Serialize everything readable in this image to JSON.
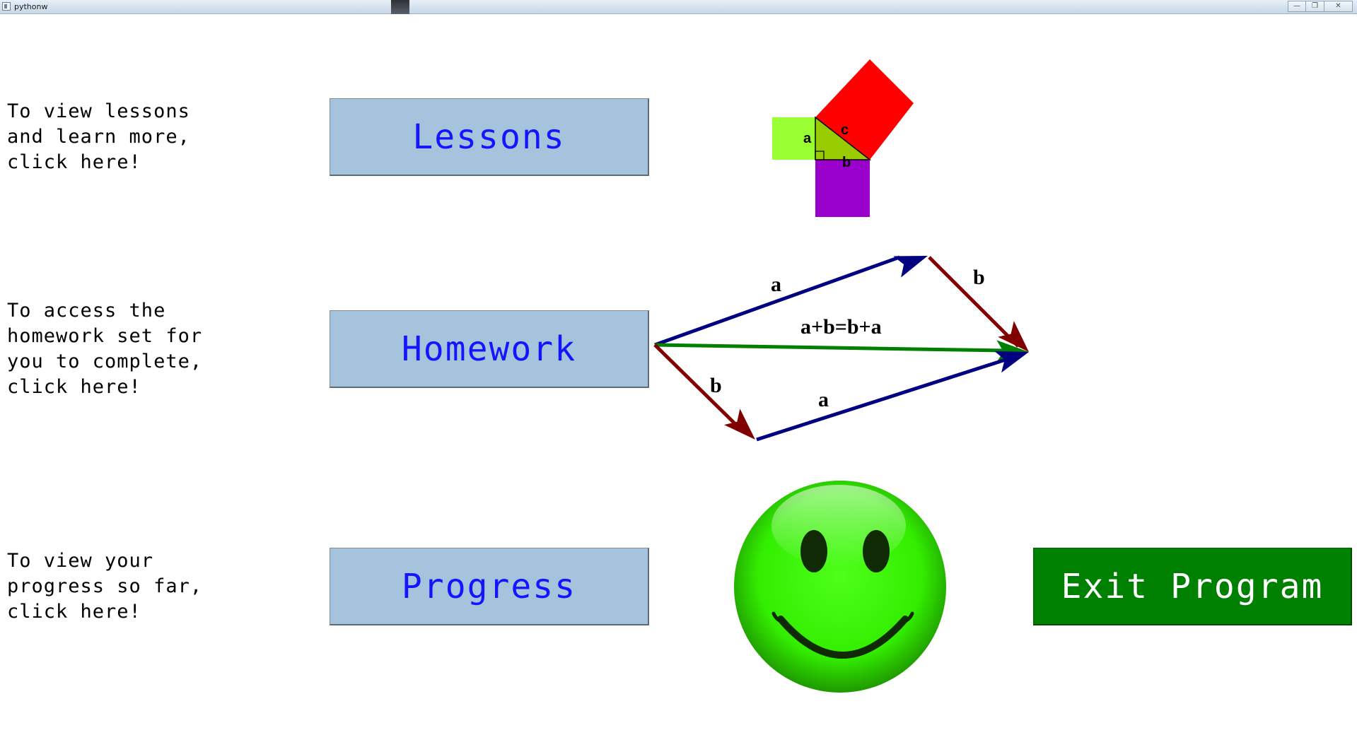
{
  "window": {
    "title": "pythonw",
    "controls": {
      "minimize_icon": "minimize-icon",
      "restore_icon": "restore-icon",
      "close_icon": "close-icon"
    }
  },
  "sections": {
    "lessons": {
      "description": "To view lessons\nand learn more,\nclick here!",
      "button_label": "Lessons"
    },
    "homework": {
      "description": "To access the\nhomework set for\nyou to complete,\nclick here!",
      "button_label": "Homework"
    },
    "progress": {
      "description": "To view your\nprogress so far,\nclick here!",
      "button_label": "Progress"
    }
  },
  "exit_button": {
    "label": "Exit Program"
  },
  "illustrations": {
    "pythagoras": {
      "label_a": "a",
      "label_b": "b",
      "label_c": "c"
    },
    "vector_addition": {
      "top_a": "a",
      "top_b": "b",
      "sum": "a+b=b+a",
      "bottom_b": "b",
      "bottom_a": "a"
    },
    "smiley": {
      "icon": "smiley-face-icon"
    }
  },
  "colors": {
    "menu_button_bg": "#a6c3de",
    "menu_button_text": "#1414ff",
    "exit_button_bg": "#008000",
    "exit_button_text": "#ffffff",
    "vector_a": "#000080",
    "vector_b": "#800000",
    "vector_sum": "#008000",
    "square_a": "#99ff33",
    "square_b": "#9900cc",
    "square_c": "#ff0000",
    "triangle": "#99cc00"
  }
}
